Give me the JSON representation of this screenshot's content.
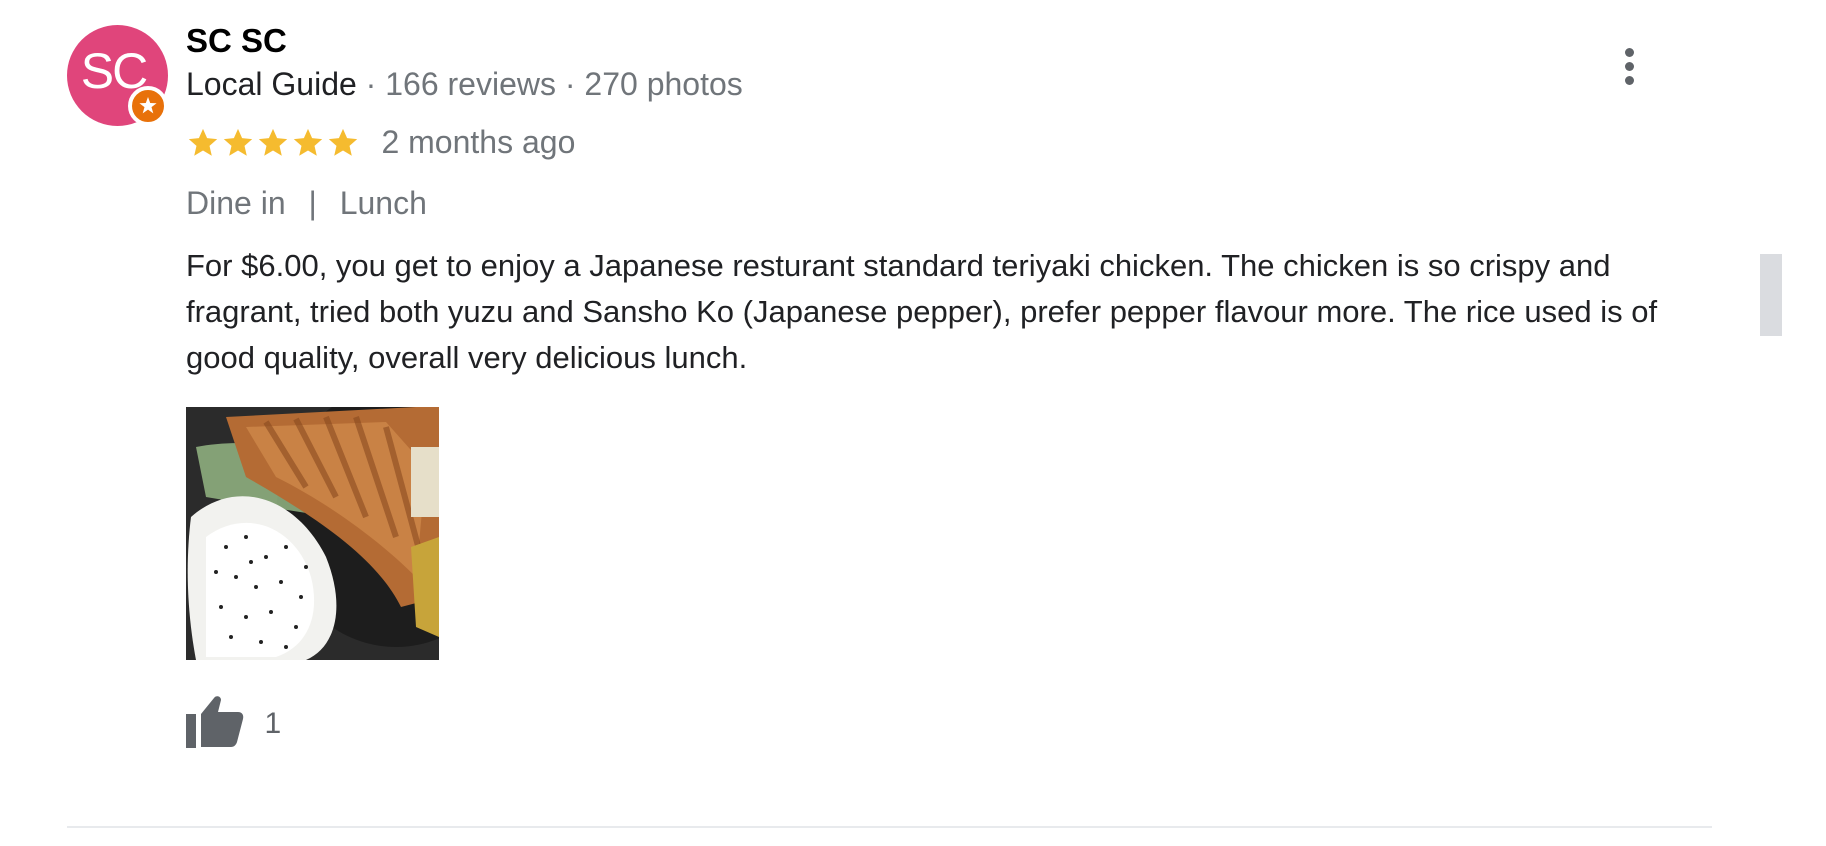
{
  "reviewer": {
    "avatar_initials": "SC",
    "avatar_color": "#e0457b",
    "name": "SC SC",
    "level": "Local Guide",
    "reviews": "166 reviews",
    "photos": "270 photos",
    "meta_separator": "·"
  },
  "review": {
    "rating": 5,
    "max_rating": 5,
    "star_color": "#f5bb2f",
    "time": "2 months ago",
    "tags": [
      "Dine in",
      "Lunch"
    ],
    "tag_separator": "|",
    "text": "For $6.00, you get to enjoy a Japanese resturant standard teriyaki chicken. The chicken is so crispy and fragrant, tried both yuzu and Sansho Ko (Japanese pepper), prefer pepper flavour more. The rice used is of good quality, overall very delicious lunch."
  },
  "actions": {
    "more_icon": "more-vertical-icon",
    "like_icon": "thumbs-up-icon",
    "like_count": "1"
  },
  "colors": {
    "secondary_text": "#70757a",
    "badge": "#e8710a"
  }
}
